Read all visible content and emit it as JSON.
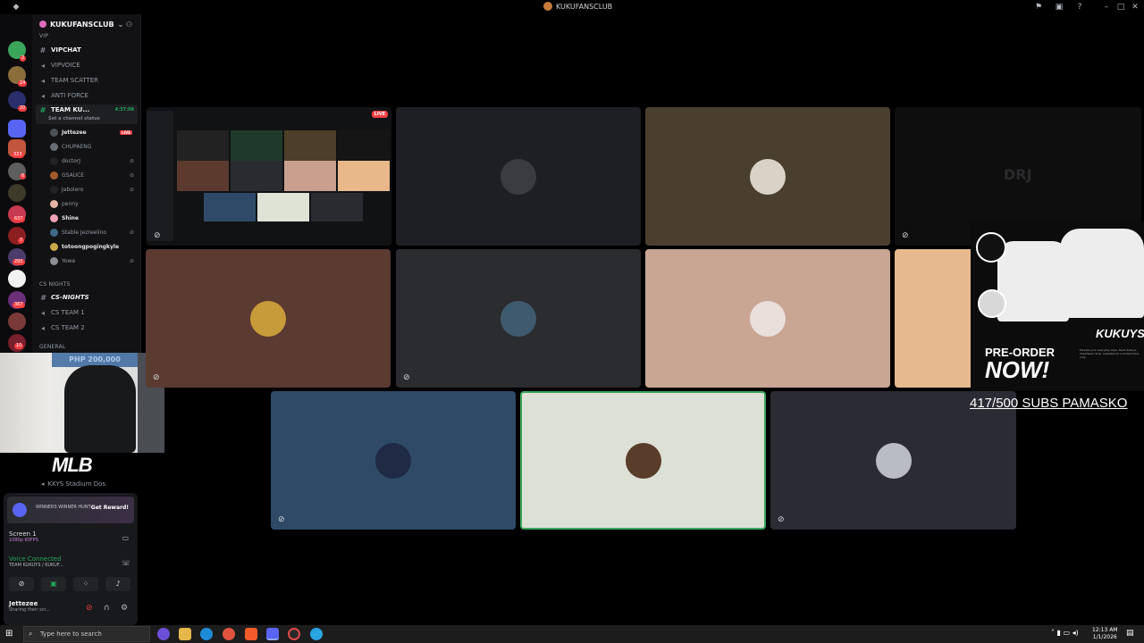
{
  "window": {
    "title": "KUKUFANSCLUB"
  },
  "guild": {
    "name": "KUKUFANSCLUB"
  },
  "channels": {
    "vip_cat": "VIP",
    "vipchat": "VIPCHAT",
    "vipvoice": "VIPVOICE",
    "team_scatter": "TEAM SCATTER",
    "anti_force": "ANTI FORCE",
    "team_kuku": "TEAM KU...",
    "team_kuku_time": "4:37:08",
    "team_kuku_status": "Set a channel status",
    "cs_nights_cat": "CS NIGHTS",
    "cs_nights": "CS-NIGHTS",
    "cs_team1": "CS TEAM 1",
    "cs_team2": "CS TEAM 2",
    "general_cat": "GENERAL",
    "stadium": "KKYS Stadium Dos"
  },
  "voice_users": [
    {
      "name": "Jettezee",
      "live": "LIVE"
    },
    {
      "name": "CHUPAENG"
    },
    {
      "name": "doctorJ"
    },
    {
      "name": "GSAUCE"
    },
    {
      "name": "Jabolero"
    },
    {
      "name": "penny"
    },
    {
      "name": "Shine"
    },
    {
      "name": "Stable Jezreelino"
    },
    {
      "name": "totoongpogingkyle"
    },
    {
      "name": "Yowe"
    }
  ],
  "rail_badges": [
    "2",
    "24",
    "20",
    "323",
    "6",
    "637",
    "7",
    "295",
    "367",
    "10"
  ],
  "webcam": {
    "banner": "PHP 200,000"
  },
  "overlay": {
    "logo": "MLB"
  },
  "panel": {
    "promo_text": "WINNERS WINNER HUNT",
    "promo_button": "Get Reward!",
    "screen_title": "Screen 1",
    "screen_sub": "1080p 60FPS",
    "voice_title": "Voice Connected",
    "voice_sub": "TEAM KUKUYS / KUKUF...",
    "user_name": "Jettezee",
    "user_status": "Sharing their scr..."
  },
  "share_preview": {
    "badge": "LIVE"
  },
  "tile_text": {
    "drj": "DRJ"
  },
  "merch": {
    "brand": "KUKUYS",
    "pre": "PRE-ORDER",
    "now": "NOW!",
    "fine": "Elevate your everyday style. Team Kukuys streetwear drop. Available for a limited time only."
  },
  "subs_goal": "417/500 SUBS PAMASKO",
  "taskbar": {
    "search_placeholder": "Type here to search",
    "time": "12:13 AM",
    "date": "1/1/2026"
  },
  "colors": {
    "discord_bg": "#121214",
    "live_red": "#f23f43",
    "voice_green": "#23a55a",
    "accent": "#5865f2"
  }
}
